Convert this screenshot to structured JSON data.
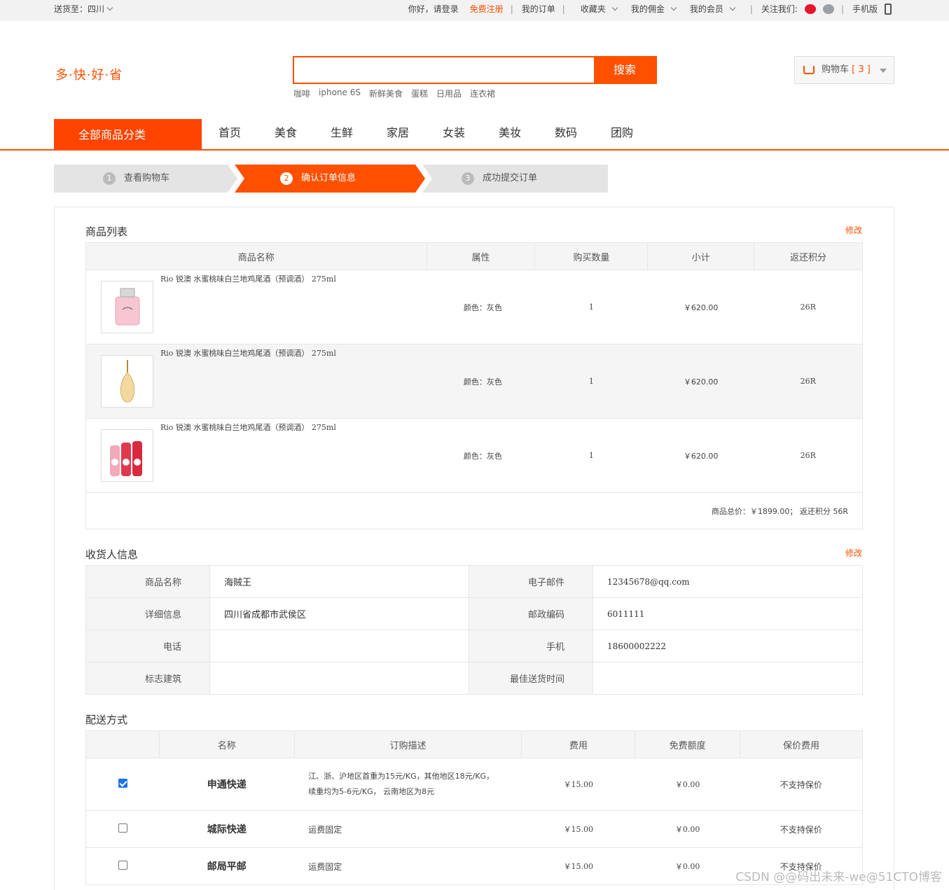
{
  "topbar": {
    "deliver_to": "送货至：四川",
    "greeting": "你好，请登录",
    "register": "免费注册",
    "my_orders": "我的订单",
    "favorites": "收藏夹",
    "commission": "我的佣金",
    "membership": "我的会员",
    "follow_us": "关注我们:",
    "mobile": "手机版"
  },
  "header": {
    "logo": "多·快·好·省",
    "search_placeholder": "",
    "search_button": "搜索",
    "hot_words": [
      "咖啡",
      "iphone 6S",
      "新鲜美食",
      "蛋糕",
      "日用品",
      "连衣裙"
    ],
    "cart_label": "购物车",
    "cart_count": "[ 3 ]"
  },
  "nav": {
    "all_categories": "全部商品分类",
    "items": [
      "首页",
      "美食",
      "生鲜",
      "家居",
      "女装",
      "美妆",
      "数码",
      "团购"
    ]
  },
  "steps": [
    {
      "num": "1",
      "label": "查看购物车"
    },
    {
      "num": "2",
      "label": "确认订单信息"
    },
    {
      "num": "3",
      "label": "成功提交订单"
    }
  ],
  "products": {
    "title": "商品列表",
    "edit": "修改",
    "headers": [
      "商品名称",
      "属性",
      "购买数量",
      "小计",
      "返还积分"
    ],
    "rows": [
      {
        "name": "Rio 锐澳 水蜜桃味白兰地鸡尾酒（预调酒） 275ml",
        "attr": "颜色：灰色",
        "qty": "1",
        "subtotal": "￥620.00",
        "points": "26R"
      },
      {
        "name": "Rio 锐澳 水蜜桃味白兰地鸡尾酒（预调酒） 275ml",
        "attr": "颜色：灰色",
        "qty": "1",
        "subtotal": "￥620.00",
        "points": "26R"
      },
      {
        "name": "Rio 锐澳 水蜜桃味白兰地鸡尾酒（预调酒） 275ml",
        "attr": "颜色：灰色",
        "qty": "1",
        "subtotal": "￥620.00",
        "points": "26R"
      }
    ],
    "total": "商品总价：￥1899.00； 返还积分 56R"
  },
  "receiver": {
    "title": "收货人信息",
    "edit": "修改",
    "rows": [
      {
        "l1": "商品名称",
        "v1": "海贼王",
        "l2": "电子邮件",
        "v2": "12345678@qq.com"
      },
      {
        "l1": "详细信息",
        "v1": "四川省成都市武侯区",
        "l2": "邮政编码",
        "v2": "6011111"
      },
      {
        "l1": "电话",
        "v1": "",
        "l2": "手机",
        "v2": "18600002222"
      },
      {
        "l1": "标志建筑",
        "v1": "",
        "l2": "最佳送货时间",
        "v2": ""
      }
    ]
  },
  "delivery": {
    "title": "配送方式",
    "headers": [
      "",
      "名称",
      "订购描述",
      "费用",
      "免费额度",
      "保价费用"
    ],
    "rows": [
      {
        "checked": true,
        "name": "申通快递",
        "desc1": "江、浙、沪地区首重为15元/KG，其他地区18元/KG，",
        "desc2": "续重均为5-6元/KG， 云南地区为8元",
        "fee": "￥15.00",
        "free": "￥0.00",
        "insure": "不支持保价"
      },
      {
        "checked": false,
        "name": "城际快递",
        "desc1": "运费固定",
        "desc2": "",
        "fee": "￥15.00",
        "free": "￥0.00",
        "insure": "不支持保价"
      },
      {
        "checked": false,
        "name": "邮局平邮",
        "desc1": "运费固定",
        "desc2": "",
        "fee": "￥15.00",
        "free": "￥0.00",
        "insure": "不支持保价"
      }
    ]
  },
  "watermark": "CSDN @@码出未来-we@51CTO博客",
  "colors": {
    "accent": "#ff5000",
    "nav_red": "#ff4400"
  }
}
